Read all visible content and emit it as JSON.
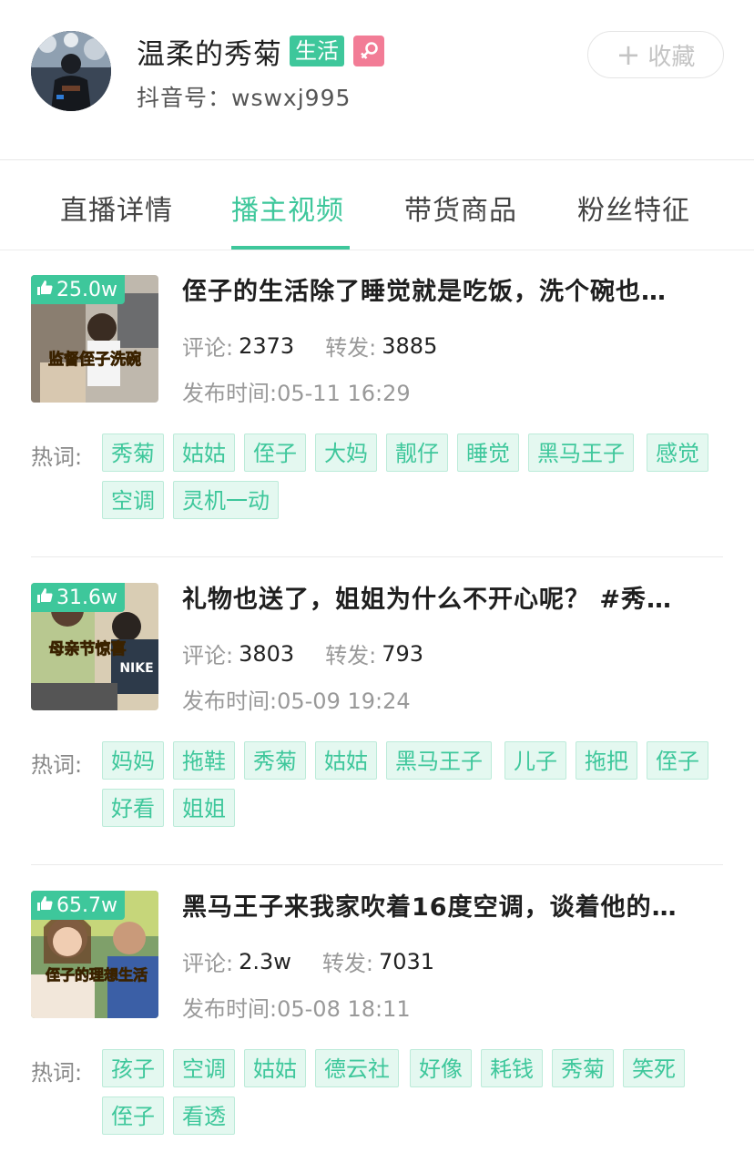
{
  "profile": {
    "name": "温柔的秀菊",
    "category_tag": "生活",
    "gender_icon": "female-icon",
    "account_label": "抖音号：",
    "account_id": "wswxj995",
    "favorite_button": "收藏"
  },
  "tabs": [
    {
      "label": "直播详情",
      "active": false
    },
    {
      "label": "播主视频",
      "active": true
    },
    {
      "label": "带货商品",
      "active": false
    },
    {
      "label": "粉丝特征",
      "active": false
    }
  ],
  "labels": {
    "comments": "评论:",
    "shares": "转发:",
    "publish_time": "发布时间:",
    "hot_words": "热词:"
  },
  "videos": [
    {
      "likes": "25.0w",
      "thumb_caption": "监督侄子洗碗",
      "title": "侄子的生活除了睡觉就是吃饭，洗个碗也…",
      "comments": "2373",
      "shares": "3885",
      "time": "05-11 16:29",
      "hot_words": [
        "秀菊",
        "姑姑",
        "侄子",
        "大妈",
        "靓仔",
        "睡觉",
        "黑马王子",
        "感觉",
        "空调",
        "灵机一动"
      ]
    },
    {
      "likes": "31.6w",
      "thumb_caption": "母亲节惊喜",
      "title": "礼物也送了，姐姐为什么不开心呢？ #秀…",
      "comments": "3803",
      "shares": "793",
      "time": "05-09 19:24",
      "hot_words": [
        "妈妈",
        "拖鞋",
        "秀菊",
        "姑姑",
        "黑马王子",
        "儿子",
        "拖把",
        "侄子",
        "好看",
        "姐姐"
      ]
    },
    {
      "likes": "65.7w",
      "thumb_caption": "侄子的理想生活",
      "title": "黑马王子来我家吹着16度空调，谈着他的…",
      "comments": "2.3w",
      "shares": "7031",
      "time": "05-08 18:11",
      "hot_words": [
        "孩子",
        "空调",
        "姑姑",
        "德云社",
        "好像",
        "耗钱",
        "秀菊",
        "笑死",
        "侄子",
        "看透"
      ]
    }
  ],
  "colors": {
    "accent": "#3ec79b",
    "chip_bg": "#e4f8f0",
    "female_badge": "#f27c96"
  }
}
